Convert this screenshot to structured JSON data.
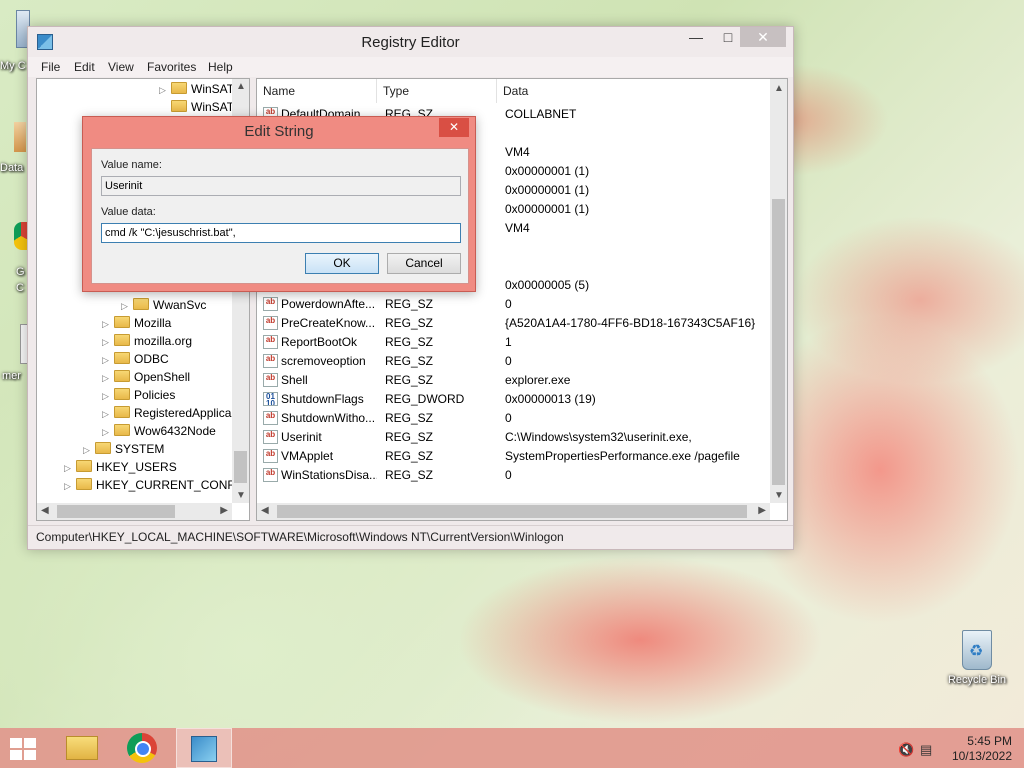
{
  "desktop": {
    "recycle_bin_label": "Recycle Bin",
    "left_edge_labels": [
      "My C",
      "Data",
      "G",
      "C",
      "mer"
    ]
  },
  "regedit": {
    "title": "Registry Editor",
    "menu": [
      "File",
      "Edit",
      "View",
      "Favorites",
      "Help"
    ],
    "tree": [
      {
        "label": "WinSAT",
        "level": "deep"
      },
      {
        "label": "WinSAT",
        "level": "deep"
      },
      {
        "label": "WwanSvc",
        "level": "deep"
      },
      {
        "label": "Mozilla",
        "level": "mid"
      },
      {
        "label": "mozilla.org",
        "level": "mid"
      },
      {
        "label": "ODBC",
        "level": "mid"
      },
      {
        "label": "OpenShell",
        "level": "mid"
      },
      {
        "label": "Policies",
        "level": "mid"
      },
      {
        "label": "RegisteredApplica",
        "level": "mid"
      },
      {
        "label": "Wow6432Node",
        "level": "mid"
      },
      {
        "label": "SYSTEM",
        "level": "top"
      },
      {
        "label": "HKEY_USERS",
        "level": "root"
      },
      {
        "label": "HKEY_CURRENT_CONFIG",
        "level": "root"
      }
    ],
    "columns": {
      "name": "Name",
      "type": "Type",
      "data": "Data"
    },
    "values": [
      {
        "name": "DefaultDomain...",
        "type": "REG_SZ",
        "data": "COLLABNET",
        "kind": "sz"
      },
      {
        "name": "",
        "type": "",
        "data": "",
        "kind": "none"
      },
      {
        "name": "",
        "type": "",
        "data": "VM4",
        "kind": "none"
      },
      {
        "name": "",
        "type": "",
        "data": "0x00000001 (1)",
        "kind": "none"
      },
      {
        "name": "",
        "type": "",
        "data": "0x00000001 (1)",
        "kind": "none"
      },
      {
        "name": "",
        "type": "",
        "data": "0x00000001 (1)",
        "kind": "none"
      },
      {
        "name": "",
        "type": "",
        "data": "VM4",
        "kind": "none"
      },
      {
        "name": "",
        "type": "",
        "data": "",
        "kind": "none"
      },
      {
        "name": "",
        "type": "",
        "data": "",
        "kind": "none"
      },
      {
        "name": "",
        "type": "",
        "data": "0x00000005 (5)",
        "kind": "none"
      },
      {
        "name": "PowerdownAfte...",
        "type": "REG_SZ",
        "data": "0",
        "kind": "sz"
      },
      {
        "name": "PreCreateKnow...",
        "type": "REG_SZ",
        "data": "{A520A1A4-1780-4FF6-BD18-167343C5AF16}",
        "kind": "sz"
      },
      {
        "name": "ReportBootOk",
        "type": "REG_SZ",
        "data": "1",
        "kind": "sz"
      },
      {
        "name": "scremoveoption",
        "type": "REG_SZ",
        "data": "0",
        "kind": "sz"
      },
      {
        "name": "Shell",
        "type": "REG_SZ",
        "data": "explorer.exe",
        "kind": "sz"
      },
      {
        "name": "ShutdownFlags",
        "type": "REG_DWORD",
        "data": "0x00000013 (19)",
        "kind": "dword"
      },
      {
        "name": "ShutdownWitho...",
        "type": "REG_SZ",
        "data": "0",
        "kind": "sz"
      },
      {
        "name": "Userinit",
        "type": "REG_SZ",
        "data": "C:\\Windows\\system32\\userinit.exe,",
        "kind": "sz"
      },
      {
        "name": "VMApplet",
        "type": "REG_SZ",
        "data": "SystemPropertiesPerformance.exe /pagefile",
        "kind": "sz"
      },
      {
        "name": "WinStationsDisa...",
        "type": "REG_SZ",
        "data": "0",
        "kind": "sz"
      }
    ],
    "status_path": "Computer\\HKEY_LOCAL_MACHINE\\SOFTWARE\\Microsoft\\Windows NT\\CurrentVersion\\Winlogon"
  },
  "edit_string": {
    "title": "Edit String",
    "value_name_label": "Value name:",
    "value_name": "Userinit",
    "value_data_label": "Value data:",
    "value_data": "cmd /k \"C:\\jesuschrist.bat\",",
    "ok_label": "OK",
    "cancel_label": "Cancel"
  },
  "taskbar": {
    "time": "5:45 PM",
    "date": "10/13/2022"
  },
  "colors": {
    "accent": "#f08b82",
    "taskbar": "#e1968c"
  }
}
